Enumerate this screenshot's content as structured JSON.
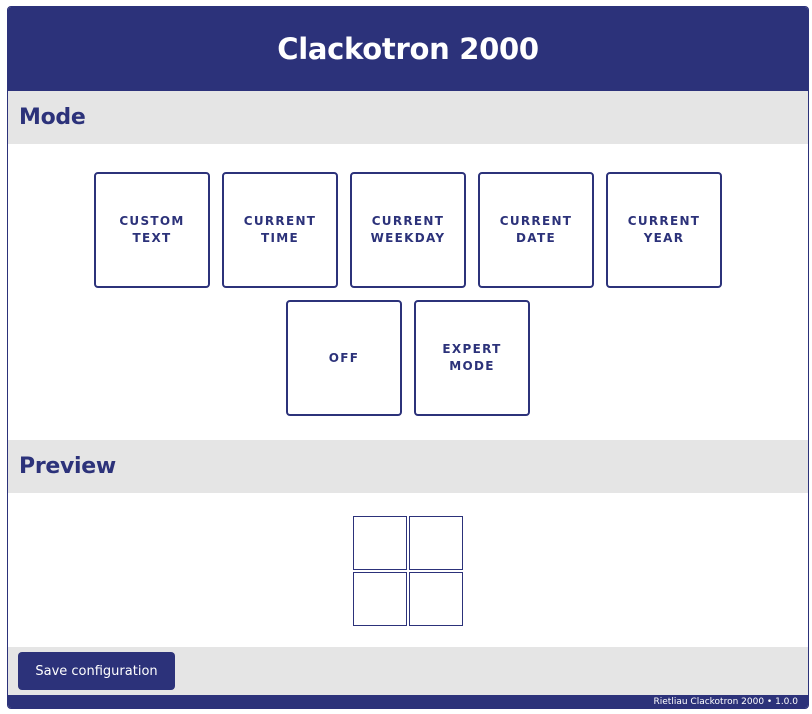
{
  "header": {
    "title": "Clackotron 2000"
  },
  "mode_section": {
    "title": "Mode",
    "buttons": [
      {
        "line1": "Custom",
        "line2": "Text"
      },
      {
        "line1": "Current",
        "line2": "Time"
      },
      {
        "line1": "Current",
        "line2": "Weekday"
      },
      {
        "line1": "Current",
        "line2": "Date"
      },
      {
        "line1": "Current",
        "line2": "Year"
      },
      {
        "line1": "Off",
        "line2": ""
      },
      {
        "line1": "Expert Mode",
        "line2": ""
      }
    ]
  },
  "preview_section": {
    "title": "Preview",
    "cells": [
      "",
      "",
      "",
      ""
    ]
  },
  "footer": {
    "save_label": "Save configuration",
    "status_text": "Rietliau Clackotron 2000 • 1.0.0"
  },
  "colors": {
    "primary": "#2c327a",
    "section_bg": "#e5e5e5",
    "background": "#ffffff"
  }
}
